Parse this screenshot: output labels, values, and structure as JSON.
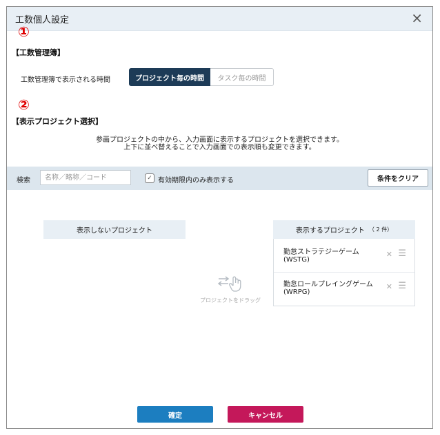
{
  "dialog": {
    "title": "工数個人設定",
    "close_icon": "×"
  },
  "markers": {
    "one": "①",
    "two": "②"
  },
  "timesheet": {
    "heading": "【工数管理簿】",
    "time_label": "工数管理簿で表示される時間",
    "options": [
      "プロジェクト毎の時間",
      "タスク毎の時間"
    ],
    "selected": "プロジェクト毎の時間"
  },
  "projects": {
    "heading": "【表示プロジェクト選択】",
    "description_line1": "参画プロジェクトの中から、入力画面に表示するプロジェクトを選択できます。",
    "description_line2": "上下に並べ替えることで入力画面での表示順も変更できます。"
  },
  "filter": {
    "search_label": "検索",
    "search_placeholder": "名称／略称／コード",
    "search_value": "",
    "checkbox_label": "有効期限内のみ表示する",
    "checkbox_checked": true,
    "clear_label": "条件をクリア"
  },
  "hidden_list": {
    "header": "表示しないプロジェクト"
  },
  "shown_list": {
    "header": "表示するプロジェクト",
    "count": "（ 2 件）",
    "items": [
      {
        "name": "勤怠ストラテジーゲーム",
        "code": "(WSTG)"
      },
      {
        "name": "勤怠ロールプレイングゲーム",
        "code": "(WRPG)"
      }
    ]
  },
  "drag_hint": {
    "text": "プロジェクトをドラッグ",
    "icon": "drag-hand-icon"
  },
  "footer": {
    "ok_label": "確定",
    "cancel_label": "キャンセル"
  },
  "colors": {
    "primary": "#1c7ec0",
    "danger": "#c4185a",
    "active_segment": "#1d3b57",
    "marker": "#e00000"
  }
}
